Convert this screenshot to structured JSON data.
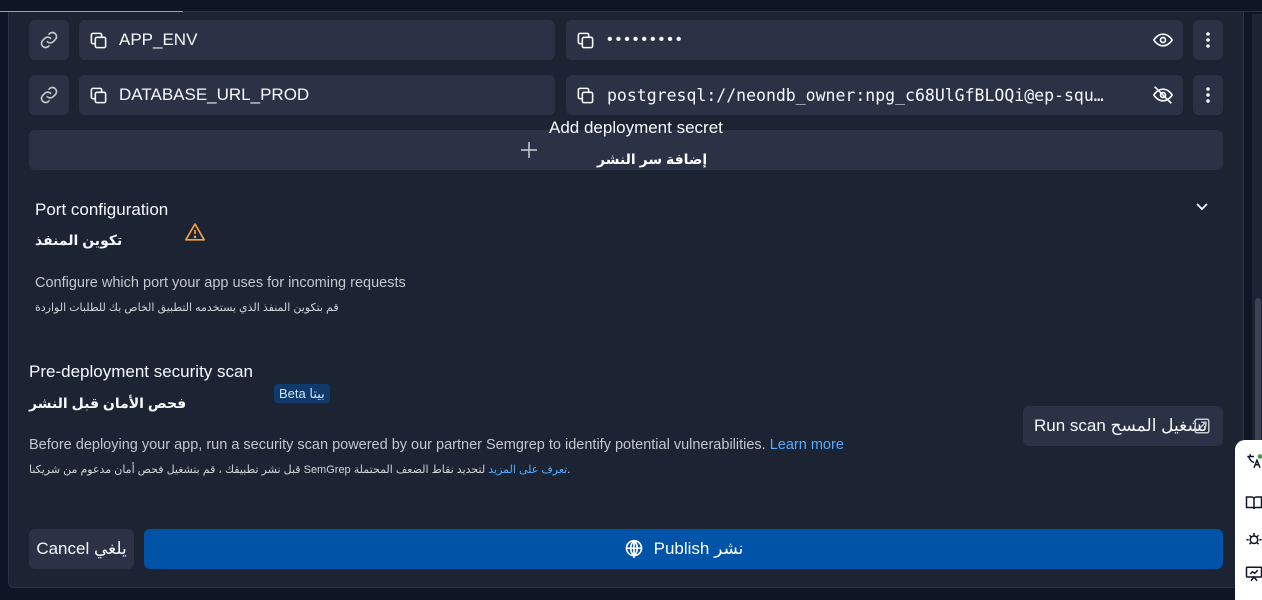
{
  "secrets": [
    {
      "key": "APP_ENV",
      "value": "•••••••••",
      "hidden": true
    },
    {
      "key": "DATABASE_URL_PROD",
      "value": "postgresql://neondb_owner:npg_c68UlGfBLOQi@ep-squ…",
      "hidden": false
    }
  ],
  "add_secret": {
    "label_en": "Add deployment secret",
    "label_ar": "إضافة سر النشر"
  },
  "port": {
    "title": "Port configuration",
    "title_ar": "تكوين المنفذ",
    "description": "Configure which port your app uses for incoming requests",
    "description_ar": "قم بتكوين المنفذ الذي يستخدمه التطبيق الخاص بك للطلبات الواردة"
  },
  "scan": {
    "title": "Pre-deployment security scan",
    "title_ar": "فحص الأمان قبل النشر",
    "badge": "Beta بيتا",
    "description": "Before deploying your app, run a security scan powered by our partner Semgrep to identify potential vulnerabilities.",
    "learn_more": "Learn more",
    "description_ar_pre": "لتحديد نقاط الضعف المحتملة. ",
    "description_ar_link": "تعرف على المزيد",
    "description_ar_post": " قبل نشر تطبيقك ، قم بتشغيل فحص أمان مدعوم من شريكنا SemGrep",
    "run_label": "Run scan تشغيل المسح"
  },
  "actions": {
    "cancel": "Cancel يلغي",
    "publish": "Publish نشر"
  },
  "colors": {
    "accent": "#0053a6",
    "link": "#57abff",
    "warning": "#f4a340",
    "surface": "#2b3245",
    "background": "#1c2333"
  }
}
